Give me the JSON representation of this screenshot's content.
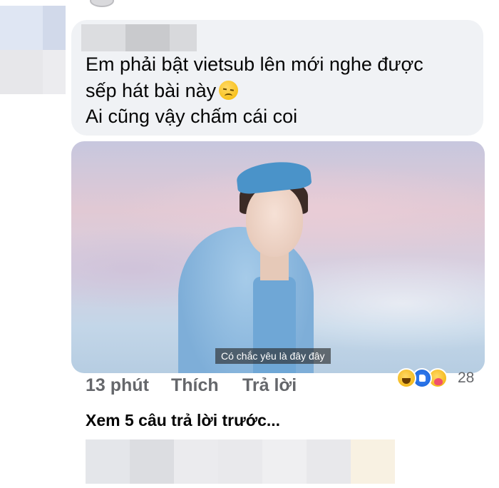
{
  "comment": {
    "lines": [
      "Em phải bật vietsub lên mới nghe được",
      "sếp hát bài này",
      "Ai cũng vậy chấm cái coi"
    ],
    "emoji": "pensive-face-icon"
  },
  "attachment": {
    "subtitle": "Có chắc yêu là đây đây"
  },
  "actions": {
    "time": "13 phút",
    "like_label": "Thích",
    "reply_label": "Trả lời"
  },
  "reactions": {
    "icons": [
      "haha-icon",
      "like-icon",
      "care-icon"
    ],
    "count": "28"
  },
  "view_more": "Xem 5 câu trả lời trước..."
}
